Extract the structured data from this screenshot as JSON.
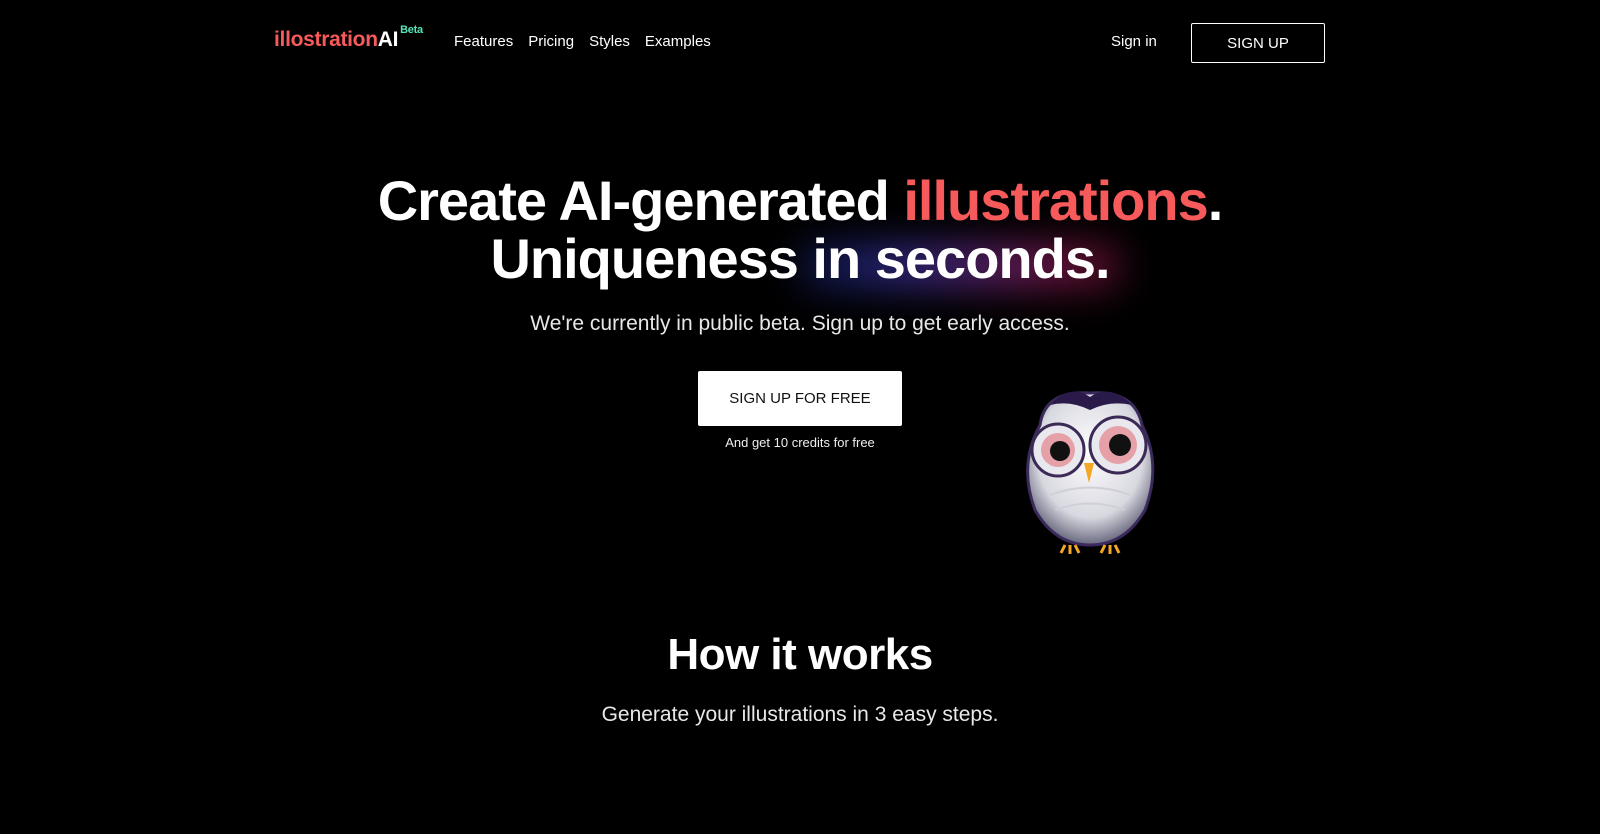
{
  "brand": {
    "name": "illostration",
    "ai": "AI",
    "badge": "Beta"
  },
  "nav": {
    "links": [
      "Features",
      "Pricing",
      "Styles",
      "Examples"
    ],
    "signin_label": "Sign in",
    "signup_label": "SIGN UP"
  },
  "hero": {
    "line1_prefix": "Create AI-generated ",
    "line1_accent": "illustrations",
    "line1_suffix": ".",
    "line2": "Uniqueness in seconds.",
    "subtitle": "We're currently in public beta. Sign up to get early access.",
    "cta_label": "SIGN UP FOR FREE",
    "cta_note": "And get 10 credits for free"
  },
  "how": {
    "title": "How it works",
    "subtitle": "Generate your illustrations in 3 easy steps."
  },
  "colors": {
    "accent": "#f65a5a",
    "badge": "#57e3b8",
    "background": "#000000"
  },
  "images": {
    "hero_illustration": "owl-illustration"
  }
}
